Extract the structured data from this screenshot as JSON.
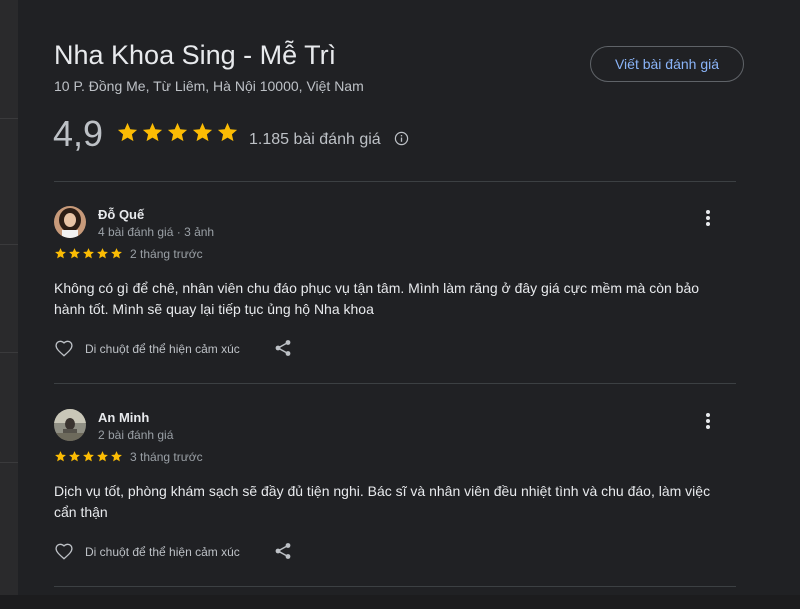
{
  "place": {
    "name": "Nha Khoa Sing - Mễ Trì",
    "address": "10 P. Đồng Me, Từ Liêm, Hà Nội 10000, Việt Nam",
    "rating": "4,9",
    "review_count": "1.185 bài đánh giá",
    "write_review_label": "Viết bài đánh giá",
    "stars": 5
  },
  "colors": {
    "star": "#fbbc04",
    "link": "#8ab4f8",
    "background": "#202124"
  },
  "icons": {
    "info": "info-circle-icon",
    "more": "more-vert-icon",
    "like": "heart-outline-icon",
    "share": "share-icon"
  },
  "reviews": [
    {
      "name": "Đỗ Quế",
      "meta": "4 bài đánh giá · 3 ảnh",
      "stars": 5,
      "time": "2 tháng trước",
      "text": "Không có gì để chê, nhân viên chu đáo phục vụ tận tâm. Mình làm răng ở đây giá cực mềm mà còn bảo hành tốt. Mình sẽ quay lại tiếp tục ủng hộ Nha khoa",
      "reaction_hint": "Di chuột để thể hiện cảm xúc"
    },
    {
      "name": "An Minh",
      "meta": "2 bài đánh giá",
      "stars": 5,
      "time": "3 tháng trước",
      "text": "Dịch vụ tốt, phòng khám sạch sẽ đầy đủ tiện nghi. Bác sĩ và nhân viên đều nhiệt tình và chu đáo, làm việc cẩn thận",
      "reaction_hint": "Di chuột để thể hiện cảm xúc"
    }
  ]
}
